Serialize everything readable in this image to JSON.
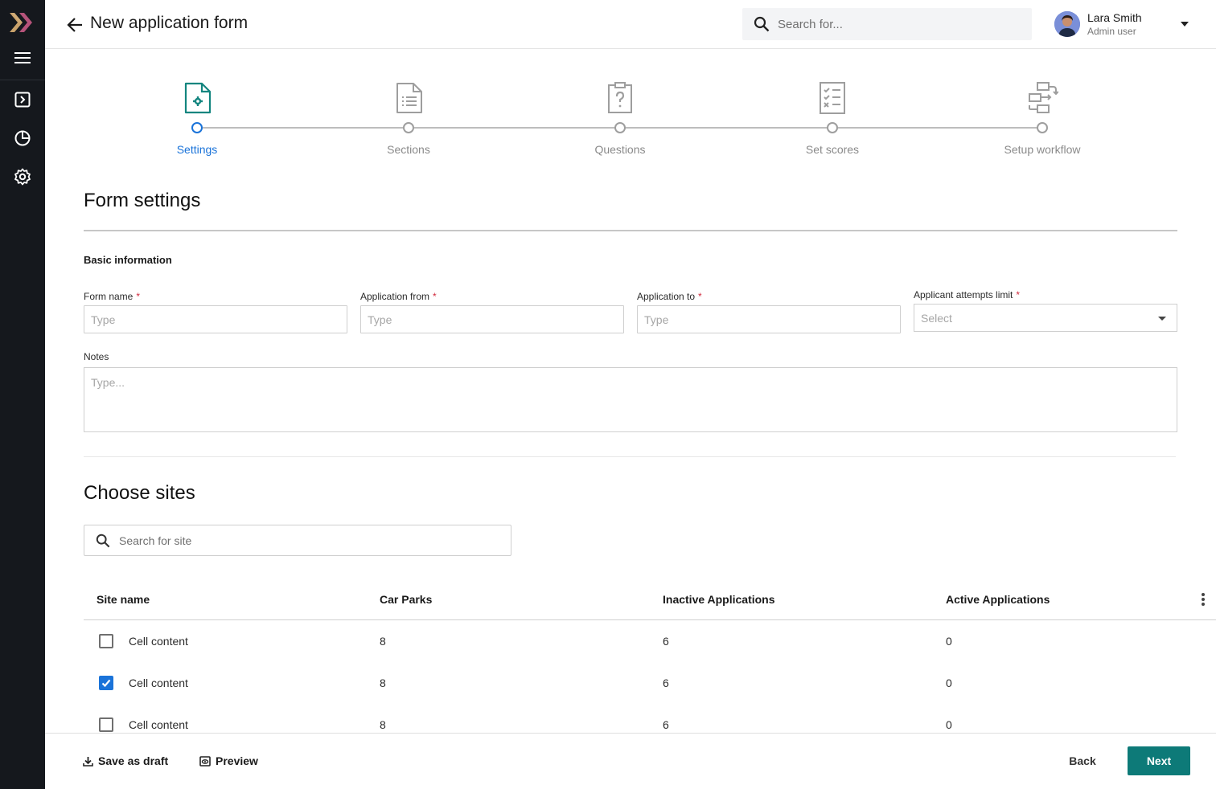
{
  "header": {
    "title": "New application form",
    "search_placeholder": "Search for...",
    "user": {
      "name": "Lara Smith",
      "role": "Admin user"
    }
  },
  "nav": {
    "icons": [
      "logo-icon",
      "menu-icon",
      "forms-icon",
      "reports-icon",
      "settings-icon"
    ]
  },
  "stepper": {
    "steps": [
      {
        "label": "Settings",
        "icon": "file-settings-icon",
        "active": true
      },
      {
        "label": "Sections",
        "icon": "file-list-icon",
        "active": false
      },
      {
        "label": "Questions",
        "icon": "clipboard-question-icon",
        "active": false
      },
      {
        "label": "Set scores",
        "icon": "checklist-icon",
        "active": false
      },
      {
        "label": "Setup workflow",
        "icon": "workflow-icon",
        "active": false
      }
    ]
  },
  "form_settings": {
    "title": "Form settings",
    "subheading": "Basic information",
    "fields": {
      "form_name": {
        "label": "Form name",
        "placeholder": "Type"
      },
      "application_from": {
        "label": "Application from",
        "placeholder": "Type"
      },
      "application_to": {
        "label": "Application to",
        "placeholder": "Type"
      },
      "attempts_limit": {
        "label": "Applicant attempts limit",
        "placeholder": "Select"
      },
      "notes": {
        "label": "Notes",
        "placeholder": "Type..."
      }
    },
    "required_mark": "*"
  },
  "sites": {
    "title": "Choose sites",
    "search_placeholder": "Search for site",
    "columns": [
      "Site name",
      "Car Parks",
      "Inactive Applications",
      "Active Applications"
    ],
    "rows": [
      {
        "name": "Cell content",
        "car_parks": "8",
        "inactive": "6",
        "active": "0",
        "checked": false
      },
      {
        "name": "Cell content",
        "car_parks": "8",
        "inactive": "6",
        "active": "0",
        "checked": true
      },
      {
        "name": "Cell content",
        "car_parks": "8",
        "inactive": "6",
        "active": "0",
        "checked": false
      }
    ]
  },
  "footer": {
    "save_draft": "Save as draft",
    "preview": "Preview",
    "back": "Back",
    "next": "Next"
  },
  "colors": {
    "rail": "#15181d",
    "accent_blue": "#1a73d9",
    "primary_teal": "#0d7a78",
    "required_red": "#d1293d",
    "icon_teal": "#13857f"
  }
}
